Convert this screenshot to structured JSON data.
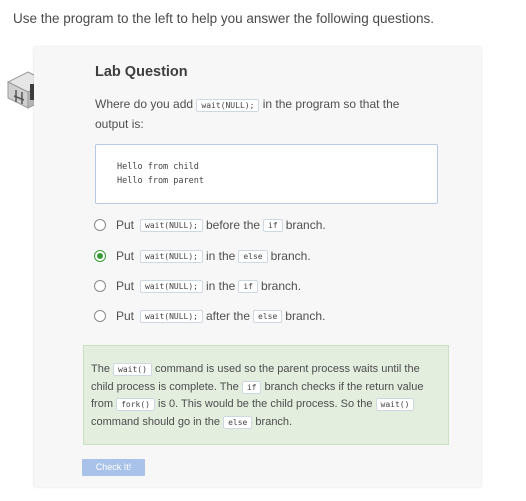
{
  "intro": "Use the program to the left to help you answer the following questions.",
  "lab": {
    "title": "Lab Question",
    "question": {
      "before": "Where do you add ",
      "code": "wait(NULL);",
      "after": " in the program so that the output is:"
    },
    "output_lines": "Hello from child\nHello from parent",
    "options": [
      {
        "put": "Put",
        "code1": "wait(NULL);",
        "mid": "before the",
        "code2": "if",
        "end": "branch.",
        "selected": false
      },
      {
        "put": "Put",
        "code1": "wait(NULL);",
        "mid": "in the",
        "code2": "else",
        "end": "branch.",
        "selected": true
      },
      {
        "put": "Put",
        "code1": "wait(NULL);",
        "mid": "in the",
        "code2": "if",
        "end": "branch.",
        "selected": false
      },
      {
        "put": "Put",
        "code1": "wait(NULL);",
        "mid": "after the",
        "code2": "else",
        "end": "branch.",
        "selected": false
      }
    ],
    "feedback": {
      "p1": "The ",
      "c1": "wait()",
      "p2": " command is used so the parent process waits until the child process is complete. The ",
      "c2": "if",
      "p3": " branch checks if the return value from ",
      "c3": "fork()",
      "p4": " is 0. This would be the child process. So the ",
      "c4": "wait()",
      "p5": " command should go in the ",
      "c5": "else",
      "p6": " branch."
    },
    "check_button": "Check It!",
    "colors": {
      "selected_radio": "#3a9a3a",
      "feedback_bg": "#e3eedf",
      "button_bg": "#a9c2ea"
    }
  }
}
